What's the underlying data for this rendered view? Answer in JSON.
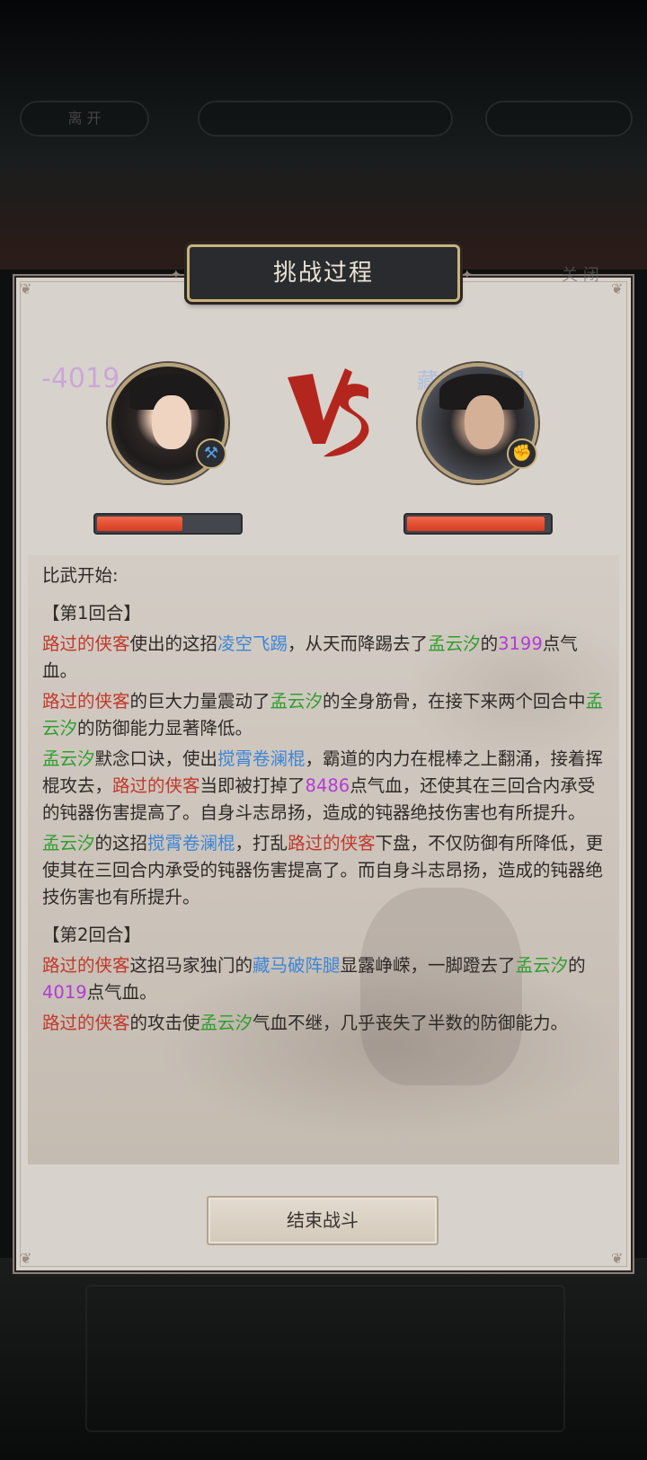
{
  "background": {
    "top_buttons": {
      "left": "离 开",
      "middle": "",
      "right": ""
    },
    "close_label": "关 闭"
  },
  "dialog": {
    "title": "挑战过程",
    "left_fighter": {
      "floating_damage": "-4019",
      "icon": "hammer-badge-icon",
      "hp_fraction": 0.6
    },
    "right_fighter": {
      "floating_skill": "藏马破阵腿",
      "icon": "fist-badge-icon",
      "hp_fraction": 0.97
    },
    "vs_label": "VS",
    "end_button": "结束战斗"
  },
  "colors": {
    "attacker": "#c0392b",
    "defender": "#2e9e2e",
    "skill": "#3d86d6",
    "number": "#b43ad8"
  },
  "log": {
    "start": "比武开始:",
    "round1": "【第1回合】",
    "round2": "【第2回合】",
    "e1": {
      "a": "路过的侠客",
      "b": "使出的这招",
      "c": "凌空飞踢",
      "d": "，从天而降踢去了",
      "e": "孟云汐",
      "f": "的",
      "g": "3199",
      "h": "点气血。"
    },
    "e2": {
      "a": "路过的侠客",
      "b": "的巨大力量震动了",
      "c": "孟云汐",
      "d": "的全身筋骨，在接下来两个回合中",
      "e": "孟云汐",
      "f": "的防御能力显著降低。"
    },
    "e3": {
      "a": "孟云汐",
      "b": "默念口诀，使出",
      "c": "搅霄卷澜棍",
      "d": "，霸道的内力在棍棒之上翻涌，接着挥棍攻去，",
      "e": "路过的侠客",
      "f": "当即被打掉了",
      "g": "8486",
      "h": "点气血，还使其在三回合内承受的钝器伤害提高了。自身斗志昂扬，造成的钝器绝技伤害也有所提升。"
    },
    "e4": {
      "a": "孟云汐",
      "b": "的这招",
      "c": "搅霄卷澜棍",
      "d": "，打乱",
      "e": "路过的侠客",
      "f": "下盘，不仅防御有所降低，更使其在三回合内承受的钝器伤害提高了。而自身斗志昂扬，造成的钝器绝技伤害也有所提升。"
    },
    "e5": {
      "a": "路过的侠客",
      "b": "这招马家独门的",
      "c": "藏马破阵腿",
      "d": "显露峥嵘，一脚蹬去了",
      "e": "孟云汐",
      "f": "的",
      "g": "4019",
      "h": "点气血。"
    },
    "e6": {
      "a": "路过的侠客",
      "b": "的攻击使",
      "c": "孟云汐",
      "d": "气血不继，几乎丧失了半数的防御能力。"
    }
  }
}
